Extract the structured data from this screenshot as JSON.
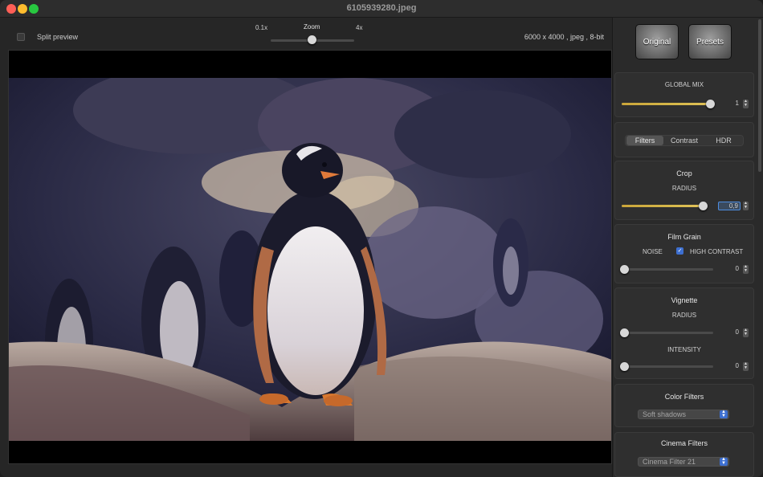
{
  "window": {
    "title": "6105939280.jpeg"
  },
  "toolbar": {
    "split_preview_label": "Split preview",
    "zoom_label": "Zoom",
    "zoom_min": "0.1x",
    "zoom_max": "4x",
    "image_info": "6000 x 4000 , jpeg , 8-bit"
  },
  "panel": {
    "original_label": "Original",
    "presets_label": "Presets",
    "global_mix": {
      "title": "GLOBAL MIX",
      "value": "1",
      "fraction": 0.9
    },
    "tabs": [
      {
        "label": "Filters",
        "active": true
      },
      {
        "label": "Contrast",
        "active": false
      },
      {
        "label": "HDR",
        "active": false
      }
    ],
    "crop": {
      "title": "Crop",
      "radius_label": "RADIUS",
      "value": "0,9",
      "fraction": 0.9
    },
    "film_grain": {
      "title": "Film Grain",
      "noise_label": "NOISE",
      "high_contrast_label": "HIGH CONTRAST",
      "value": "0",
      "fraction": 0
    },
    "vignette": {
      "title": "Vignette",
      "radius_label": "RADIUS",
      "radius_value": "0",
      "intensity_label": "INTENSITY",
      "intensity_value": "0"
    },
    "color_filters": {
      "title": "Color Filters",
      "selected": "Soft shadows"
    },
    "cinema_filters": {
      "title": "Cinema Filters",
      "selected": "Cinema Filter 21"
    }
  },
  "colors": {
    "accent": "#3d6fd0",
    "slider_fill": "#d6b84a"
  }
}
